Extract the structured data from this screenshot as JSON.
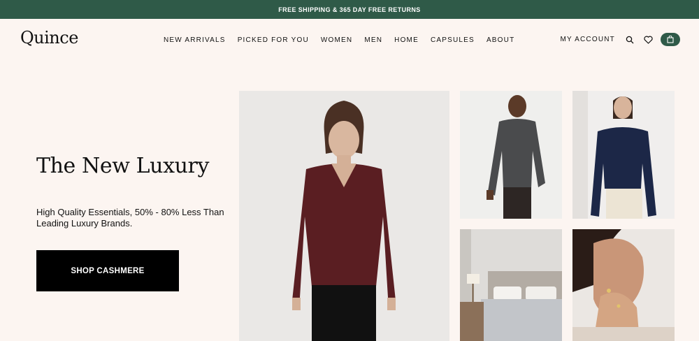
{
  "promo": {
    "text": "FREE SHIPPING & 365 DAY FREE RETURNS"
  },
  "header": {
    "logo": "Quince",
    "menu": [
      "NEW ARRIVALS",
      "PICKED FOR YOU",
      "WOMEN",
      "MEN",
      "HOME",
      "CAPSULES",
      "ABOUT"
    ],
    "account_label": "MY ACCOUNT",
    "icons": [
      "search-icon",
      "heart-icon",
      "shopping-bag-icon"
    ]
  },
  "hero": {
    "title": "The New Luxury",
    "subtitle": "High Quality Essentials, 50% - 80% Less Than Leading Luxury Brands.",
    "cta_label": "SHOP CASHMERE"
  },
  "colors": {
    "brand_green": "#2f5a48",
    "background": "#fcf5f1",
    "cta": "#000000"
  }
}
